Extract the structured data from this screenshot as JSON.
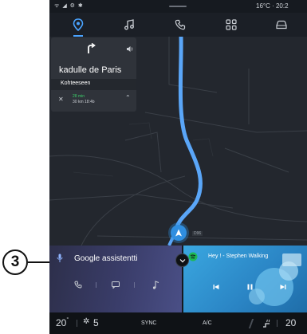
{
  "status": {
    "left_icons": "ᯤ ◢ ⚙ ✱",
    "temp_time": "16°C · 20:2"
  },
  "nav_tabs": [
    {
      "icon": "map-pin-icon",
      "active": true
    },
    {
      "icon": "music-note-icon",
      "active": false
    },
    {
      "icon": "phone-icon",
      "active": false
    },
    {
      "icon": "apps-grid-icon",
      "active": false
    },
    {
      "icon": "car-icon",
      "active": false
    }
  ],
  "nav_card": {
    "street": "kadulle  de Paris",
    "next_road": "Kohteeseen",
    "eta_time": "28 min",
    "distance_eta": "30 km  18:4b"
  },
  "map_label": "D96",
  "google": {
    "title": "Google assistentti"
  },
  "music": {
    "track": "Hey ! - Stephen Walking"
  },
  "bottom": {
    "left_temp": "20",
    "left_temp_deg": "°",
    "fan_level": "5",
    "sync": "SYNC",
    "ac": "A/C",
    "right_temp": "20"
  },
  "callout": {
    "number": "3"
  },
  "colors": {
    "accent": "#2f8ee0",
    "route": "#4f9ef4",
    "screen_bg": "#161a20"
  }
}
